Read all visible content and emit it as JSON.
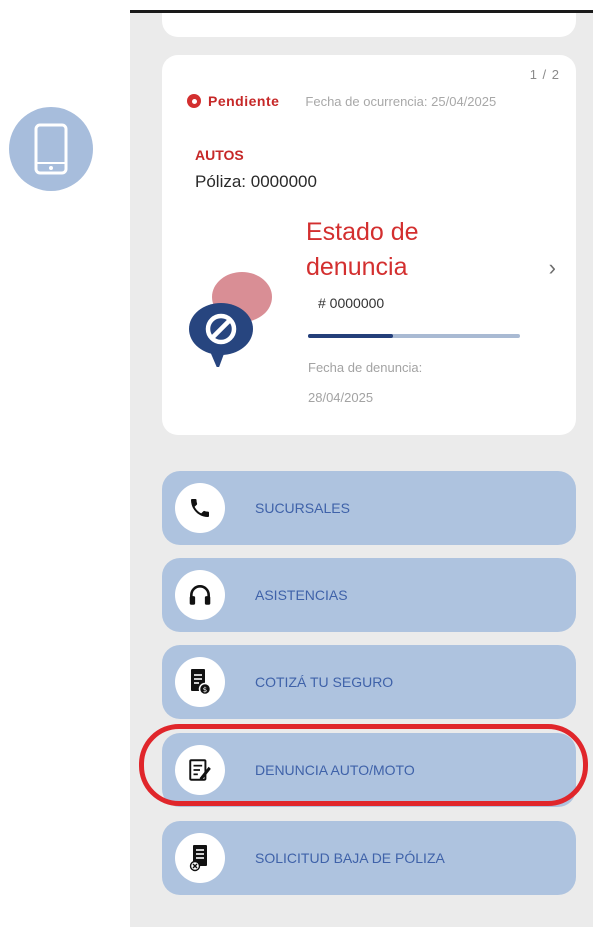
{
  "side_badge": {
    "icon": "smartphone-icon",
    "color": "#a7bddc"
  },
  "claim_card": {
    "pager": "1 / 2",
    "status": "Pendiente",
    "occurrence_date": "Fecha de ocurrencia: 25/04/2025",
    "branch": "AUTOS",
    "policy": "Póliza: 0000000",
    "title": "Estado de denuncia",
    "number": "# 0000000",
    "progress": 0.4,
    "claim_date_label": "Fecha de denuncia:",
    "claim_date": "28/04/2025"
  },
  "menu": [
    {
      "label": "SUCURSALES",
      "icon": "phone-icon"
    },
    {
      "label": "ASISTENCIAS",
      "icon": "headset-icon"
    },
    {
      "label": "COTIZÁ TU SEGURO",
      "icon": "quote-document-icon"
    },
    {
      "label": "DENUNCIA AUTO/MOTO",
      "icon": "edit-document-icon",
      "highlighted": true
    },
    {
      "label": "SOLICITUD BAJA DE PÓLIZA",
      "icon": "cancel-document-icon"
    }
  ],
  "colors": {
    "accent_red": "#d32f2f",
    "menu_bg": "#aec3df",
    "menu_text": "#3f62a9",
    "highlight": "#e0262b"
  }
}
